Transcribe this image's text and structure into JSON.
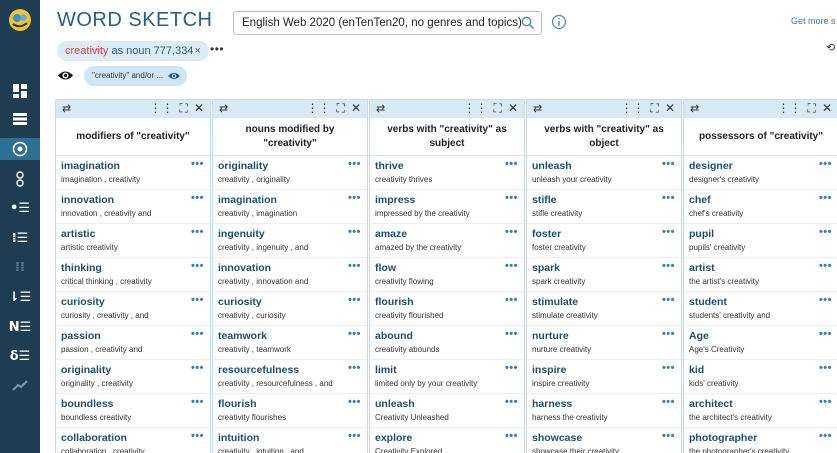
{
  "header": {
    "title": "WORD SKETCH",
    "corpus": "English Web 2020 (enTenTen20, no genres and topics)",
    "get_more": "Get more s"
  },
  "query_chip": {
    "lemma": "creativity",
    "rest": " as noun 777,334",
    "close": "×"
  },
  "more": "•••",
  "filter_chip": {
    "label": "\"creativity\" and/or ..."
  },
  "nav": {
    "icons": [
      "logo-icon",
      "grid-icon",
      "list-icon",
      "concordance-icon",
      "thesaurus-icon",
      "wordlist-icon",
      "keywords-icon",
      "ngrams-icon",
      "frequency-icon",
      "ne-icon",
      "diff-icon",
      "trends-icon"
    ]
  },
  "toolbar_icons": {
    "swap": "⇄",
    "tools": [
      "⋮⋮",
      "⛶",
      "✕"
    ]
  },
  "columns": [
    {
      "header": "modifiers of \"creativity\"",
      "rows": [
        {
          "word": "imagination",
          "example": "imagination , creativity"
        },
        {
          "word": "innovation",
          "example": "innovation , creativity and"
        },
        {
          "word": "artistic",
          "example": "artistic creativity"
        },
        {
          "word": "thinking",
          "example": "critical thinking , creativity"
        },
        {
          "word": "curiosity",
          "example": "curiosity , creativity , and"
        },
        {
          "word": "passion",
          "example": "passion , creativity and"
        },
        {
          "word": "originality",
          "example": "originality , creativity"
        },
        {
          "word": "boundless",
          "example": "boundless creativity"
        },
        {
          "word": "collaboration",
          "example": "collaboration , creativity"
        }
      ]
    },
    {
      "header": "nouns modified by \"creativity\"",
      "rows": [
        {
          "word": "originality",
          "example": "creativity , originality"
        },
        {
          "word": "imagination",
          "example": "creativity , imagination"
        },
        {
          "word": "ingenuity",
          "example": "creativity , ingenuity , and"
        },
        {
          "word": "innovation",
          "example": "creativity , innovation and"
        },
        {
          "word": "curiosity",
          "example": "creativity , curiosity"
        },
        {
          "word": "teamwork",
          "example": "creativity , teamwork"
        },
        {
          "word": "resourcefulness",
          "example": "creativity , resourcefulness , and"
        },
        {
          "word": "flourish",
          "example": "creativity flourishes"
        },
        {
          "word": "intuition",
          "example": "creativity , intuition , and"
        }
      ]
    },
    {
      "header": "verbs with \"creativity\" as subject",
      "rows": [
        {
          "word": "thrive",
          "example": "creativity thrives"
        },
        {
          "word": "impress",
          "example": "impressed by the creativity"
        },
        {
          "word": "amaze",
          "example": "amazed by the creativity"
        },
        {
          "word": "flow",
          "example": "creativity flowing"
        },
        {
          "word": "flourish",
          "example": "creativity flourished"
        },
        {
          "word": "abound",
          "example": "creativity abounds"
        },
        {
          "word": "limit",
          "example": "limited only by your creativity"
        },
        {
          "word": "unleash",
          "example": "Creativity Unleashed"
        },
        {
          "word": "explore",
          "example": "Creativity Explored"
        }
      ]
    },
    {
      "header": "verbs with \"creativity\" as object",
      "rows": [
        {
          "word": "unleash",
          "example": "unleash your creativity"
        },
        {
          "word": "stifle",
          "example": "stifle creativity"
        },
        {
          "word": "foster",
          "example": "foster creativity"
        },
        {
          "word": "spark",
          "example": "spark creativity"
        },
        {
          "word": "stimulate",
          "example": "stimulate creativity"
        },
        {
          "word": "nurture",
          "example": "nurture creativity"
        },
        {
          "word": "inspire",
          "example": "inspire creativity"
        },
        {
          "word": "harness",
          "example": "harness the creativity"
        },
        {
          "word": "showcase",
          "example": "showcase their creativity"
        }
      ]
    },
    {
      "header": "possessors of \"creativity\"",
      "rows": [
        {
          "word": "designer",
          "example": "designer's creativity"
        },
        {
          "word": "chef",
          "example": "chef's creativity"
        },
        {
          "word": "pupil",
          "example": "pupils' creativity"
        },
        {
          "word": "artist",
          "example": "the artist's creativity"
        },
        {
          "word": "student",
          "example": "students' creativity and"
        },
        {
          "word": "Age",
          "example": "Age's Creativity"
        },
        {
          "word": "kid",
          "example": "kids' creativity"
        },
        {
          "word": "architect",
          "example": "the architect's creativity"
        },
        {
          "word": "photographer",
          "example": "the photographer's creativity"
        }
      ]
    }
  ],
  "row_menu": "•••",
  "colors": {
    "nav_bg": "#1f3d52",
    "nav_active": "#2e6f94",
    "title": "#2a5f86",
    "lemma": "#e23f3f",
    "toolbar": "#d6e9f5",
    "word": "#1d4e70"
  }
}
